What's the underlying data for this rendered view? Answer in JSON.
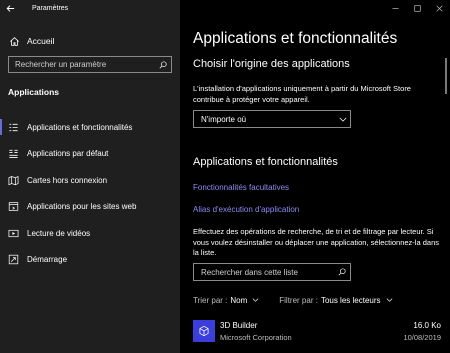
{
  "window": {
    "title": "Paramètres",
    "controls": [
      "minimize-icon",
      "maximize-icon",
      "close-icon"
    ]
  },
  "sidebar": {
    "home_label": "Accueil",
    "search_placeholder": "Rechercher un paramètre",
    "section_title": "Applications",
    "items": [
      {
        "label": "Applications et fonctionnalités",
        "icon": "apps-list-icon",
        "active": true
      },
      {
        "label": "Applications par défaut",
        "icon": "default-apps-icon",
        "active": false
      },
      {
        "label": "Cartes hors connexion",
        "icon": "offline-maps-icon",
        "active": false
      },
      {
        "label": "Applications pour les sites web",
        "icon": "apps-websites-icon",
        "active": false
      },
      {
        "label": "Lecture de vidéos",
        "icon": "video-playback-icon",
        "active": false
      },
      {
        "label": "Démarrage",
        "icon": "startup-icon",
        "active": false
      }
    ]
  },
  "main": {
    "title": "Applications et fonctionnalités",
    "origin": {
      "heading": "Choisir l'origine des applications",
      "description": "L'installation d'applications uniquement à partir du Microsoft Store contribue à protéger votre appareil.",
      "dropdown_value": "N'importe où"
    },
    "features": {
      "heading": "Applications et fonctionnalités",
      "link_optional": "Fonctionnalités facultatives",
      "link_alias": "Alias d'exécution d'application",
      "description": "Effectuez des opérations de recherche, de tri et de filtrage par lecteur. Si vous voulez désinstaller ou déplacer une application, sélectionnez-la dans la liste.",
      "search_placeholder": "Rechercher dans cette liste",
      "sort_label": "Trier par :",
      "sort_value": "Nom",
      "filter_label": "Filtrer par :",
      "filter_value": "Tous les lecteurs"
    },
    "apps": [
      {
        "name": "3D Builder",
        "publisher": "Microsoft Corporation",
        "size": "16.0 Ko",
        "date": "10/08/2019"
      }
    ]
  },
  "colors": {
    "sidebar_bg": "#1f1f1f",
    "main_bg": "#000000",
    "accent": "#6b6bd6",
    "link": "#8b8bf0",
    "app_icon_bg": "#3b3ed8"
  }
}
